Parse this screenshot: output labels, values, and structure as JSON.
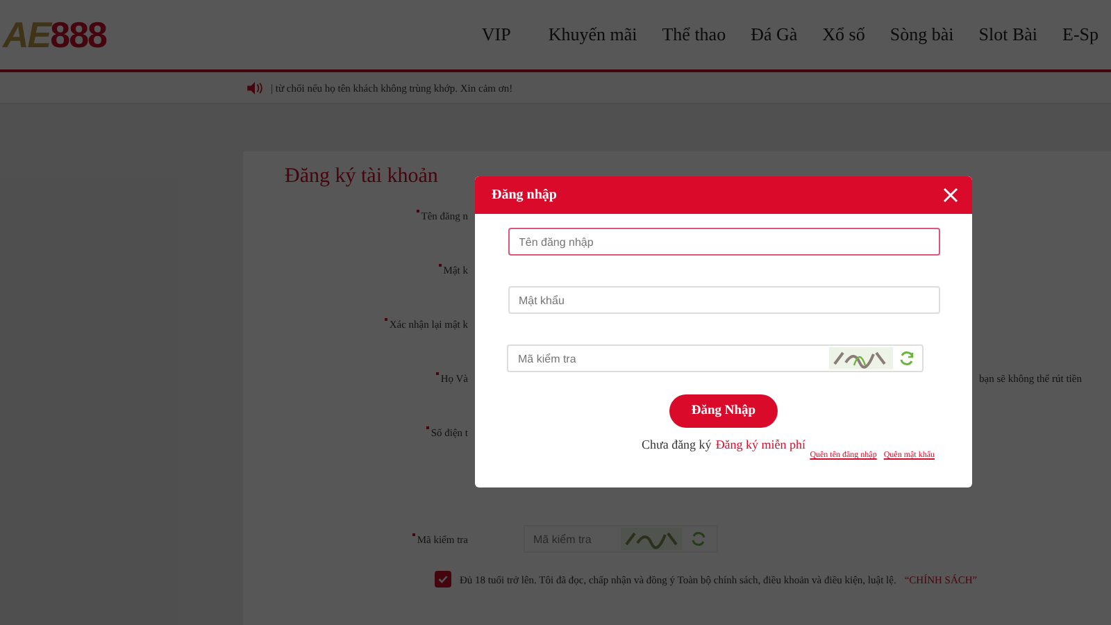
{
  "header": {
    "logo": {
      "prefix": "AE",
      "suffix": "888"
    },
    "nav": [
      "VIP",
      "Khuyến mãi",
      "Thể thao",
      "Đá Gà",
      "Xổ số",
      "Sòng bài",
      "Slot Bài",
      "E-Sp"
    ]
  },
  "notice": {
    "text": "| từ chối nếu họ tên khách không trùng khớp. Xin cảm ơn!"
  },
  "register": {
    "title": "Đăng ký tài khoản",
    "fields": [
      {
        "label": "Tên đăng n",
        "required": true
      },
      {
        "label": "Mật k",
        "required": true
      },
      {
        "label": "Xác nhận lại mật k",
        "required": true
      },
      {
        "label": "Họ Và",
        "required": true
      },
      {
        "label": "Số điện t",
        "required": true
      }
    ],
    "note": "bạn sẽ không thể rút tiền",
    "captcha": {
      "label": "Mã kiểm tra",
      "required": true,
      "placeholder": "Mã kiểm tra"
    },
    "agreement": {
      "checked": true,
      "text": "Đủ 18 tuổi trở lên. Tôi đã đọc, chấp nhận và đồng ý Toàn bộ chính sách, điều khoản và điều kiện, luật lệ.",
      "link": "“CHÍNH SÁCH”"
    }
  },
  "modal": {
    "title": "Đăng nhập",
    "fields": [
      {
        "kind": "text",
        "placeholder": "Tên đăng nhập",
        "focused": true
      },
      {
        "kind": "password",
        "placeholder": "Mật khẩu",
        "focused": false
      },
      {
        "kind": "captcha",
        "placeholder": "Mã kiểm tra",
        "focused": false
      }
    ],
    "submit": "Đăng Nhập",
    "signup_prompt": "Chưa đăng ký",
    "signup_link": "Đăng ký miễn phí",
    "links": [
      "Quên tên đăng nhập",
      "Quên mật khẩu"
    ]
  }
}
